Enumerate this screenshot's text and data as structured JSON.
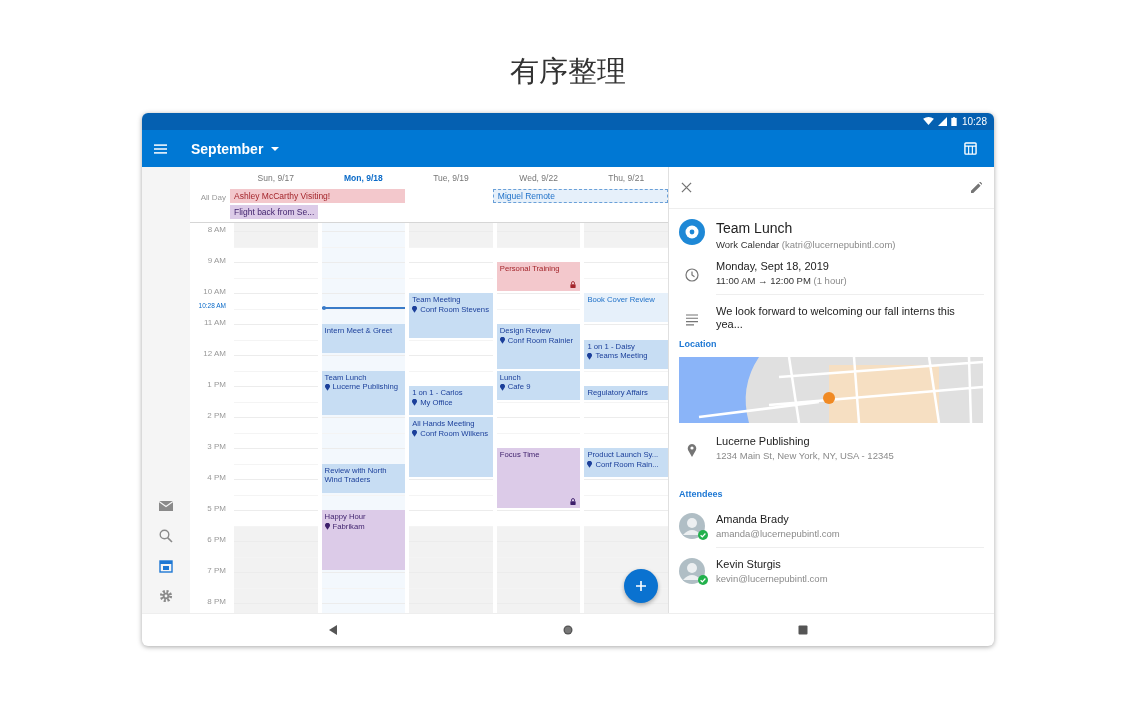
{
  "page_title": "有序整理",
  "status_bar": {
    "time": "10:28"
  },
  "app_bar": {
    "month": "September"
  },
  "rail": [
    {
      "selected": false
    },
    {
      "selected": false
    },
    {
      "selected": true
    },
    {
      "selected": false
    }
  ],
  "calendar": {
    "all_day_label": "All Day",
    "hours": [
      "8 AM",
      "9 AM",
      "10 AM",
      "11 AM",
      "12 AM",
      "1 PM",
      "2 PM",
      "3 PM",
      "4 PM",
      "5 PM",
      "6 PM",
      "7 PM",
      "8 PM"
    ],
    "now_label": "10:28 AM",
    "days": [
      {
        "label": "Sun, 9/17",
        "today": false,
        "all_day": [
          {
            "title": "Ashley McCarthy Visiting!",
            "kind": "personal",
            "continues": true
          },
          {
            "title": "Flight back from Se...",
            "kind": "social",
            "continues": false
          }
        ]
      },
      {
        "label": "Mon, 9/18",
        "today": true,
        "events": [
          {
            "title": "Intern Meet & Greet",
            "kind": "work",
            "private": false
          },
          {
            "title": "Team Lunch",
            "location": "Lucerne Publishing",
            "kind": "work",
            "private": false
          },
          {
            "title": "Review with North Wind Traders",
            "kind": "work",
            "private": false
          },
          {
            "title": "Happy Hour",
            "location": "Fabrikam",
            "kind": "social",
            "private": false
          }
        ]
      },
      {
        "label": "Tue, 9/19",
        "today": false,
        "events": [
          {
            "title": "Team Meeting",
            "location": "Conf Room Stevens",
            "kind": "work",
            "private": false
          },
          {
            "title": "1 on 1 - Carlos",
            "location": "My Office",
            "kind": "work",
            "private": false
          },
          {
            "title": "All Hands Meeting",
            "location": "Conf Room Wilkens",
            "kind": "work",
            "private": false
          }
        ]
      },
      {
        "label": "Wed, 9/22",
        "today": false,
        "all_day": [
          {
            "title": "Miguel Remote",
            "kind": "tentative",
            "continues": true
          }
        ],
        "events": [
          {
            "title": "Personal Training",
            "kind": "personal",
            "private": true
          },
          {
            "title": "Design Review",
            "location": "Conf Room Rainier",
            "kind": "work",
            "private": false
          },
          {
            "title": "Lunch",
            "location": "Cafe 9",
            "kind": "work",
            "private": false
          },
          {
            "title": "Focus Time",
            "kind": "social",
            "private": true
          }
        ]
      },
      {
        "label": "Thu, 9/21",
        "today": false,
        "events": [
          {
            "title": "Book Cover Review",
            "kind": "tentative",
            "private": false
          },
          {
            "title": "1 on 1 - Daisy",
            "location": "Teams Meeting",
            "kind": "work",
            "private": false
          },
          {
            "title": "Regulatory Affairs",
            "kind": "work",
            "private": false
          },
          {
            "title": "Product Launch Sy...",
            "location": "Conf Room Rain...",
            "kind": "work",
            "private": false
          }
        ]
      }
    ]
  },
  "detail": {
    "title": "Team Lunch",
    "calendar": "Work Calendar",
    "account": "(katri@lucernepubintl.com)",
    "date": "Monday, Sept 18, 2019",
    "time": "11:00 AM → 12:00 PM",
    "duration": "(1 hour)",
    "description": "We look forward to welcoming our fall interns this yea...",
    "location_heading": "Location",
    "location_name": "Lucerne Publishing",
    "address": "1234 Main St, New York, NY, USA - 12345",
    "attendees_heading": "Attendees",
    "attendees": [
      {
        "name": "Amanda Brady",
        "email": "amanda@lucernepubintl.com",
        "accepted": true
      },
      {
        "name": "Kevin Sturgis",
        "email": "kevin@lucernepubintl.com",
        "accepted": true
      }
    ]
  }
}
